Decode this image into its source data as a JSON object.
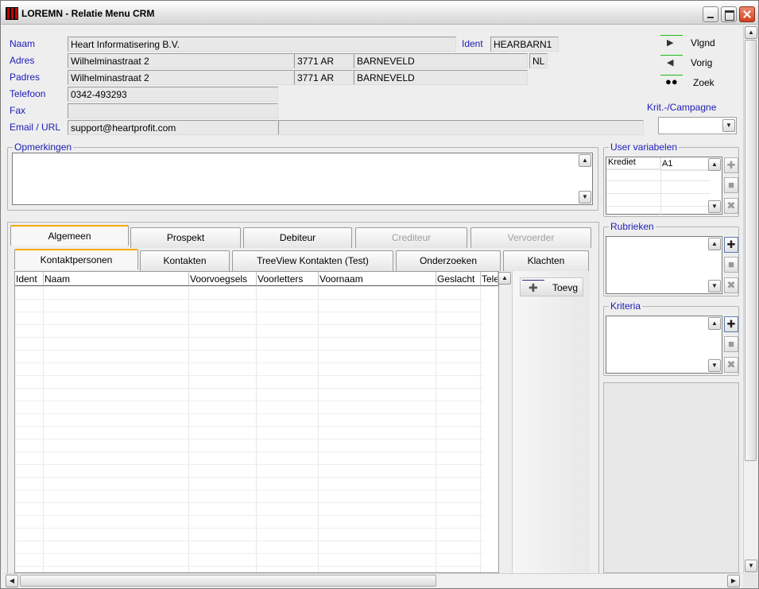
{
  "window": {
    "title": "LOREMN - Relatie Menu CRM"
  },
  "contact": {
    "naam_label": "Naam",
    "naam": "Heart Informatisering B.V.",
    "ident_label": "Ident",
    "ident": "HEARBARN1",
    "adres_label": "Adres",
    "adres_straat": "Wilhelminastraat 2",
    "adres_postcode": "3771 AR",
    "adres_plaats": "BARNEVELD",
    "adres_land": "NL",
    "padres_label": "Padres",
    "padres_straat": "Wilhelminastraat 2",
    "padres_postcode": "3771 AR",
    "padres_plaats": "BARNEVELD",
    "telefoon_label": "Telefoon",
    "telefoon": "0342-493293",
    "fax_label": "Fax",
    "fax": "",
    "email_label": "Email / URL",
    "email": "support@heartprofit.com",
    "url": ""
  },
  "nav": {
    "next": "Vlgnd",
    "prev": "Vorig",
    "search": "Zoek",
    "campaign_label": "Krit.-/Campagne",
    "campaign_value": ""
  },
  "opmerkingen": {
    "title": "Opmerkingen"
  },
  "user_variabelen": {
    "title": "User variabelen",
    "rows": [
      {
        "name": "Krediet",
        "value": "A1"
      }
    ]
  },
  "rubrieken": {
    "title": "Rubrieken"
  },
  "kriteria": {
    "title": "Kriteria"
  },
  "tabs_main": [
    "Algemeen",
    "Prospekt",
    "Debiteur",
    "Crediteur",
    "Vervoerder"
  ],
  "tabs_sub": [
    "Kontaktpersonen",
    "Kontakten",
    "TreeView Kontakten (Test)",
    "Onderzoeken",
    "Klachten"
  ],
  "grid": {
    "columns": [
      "Ident",
      "Naam",
      "Voorvoegsels",
      "Voorletters",
      "Voornaam",
      "Geslacht",
      "Tele"
    ]
  },
  "add_button": "Toevg"
}
